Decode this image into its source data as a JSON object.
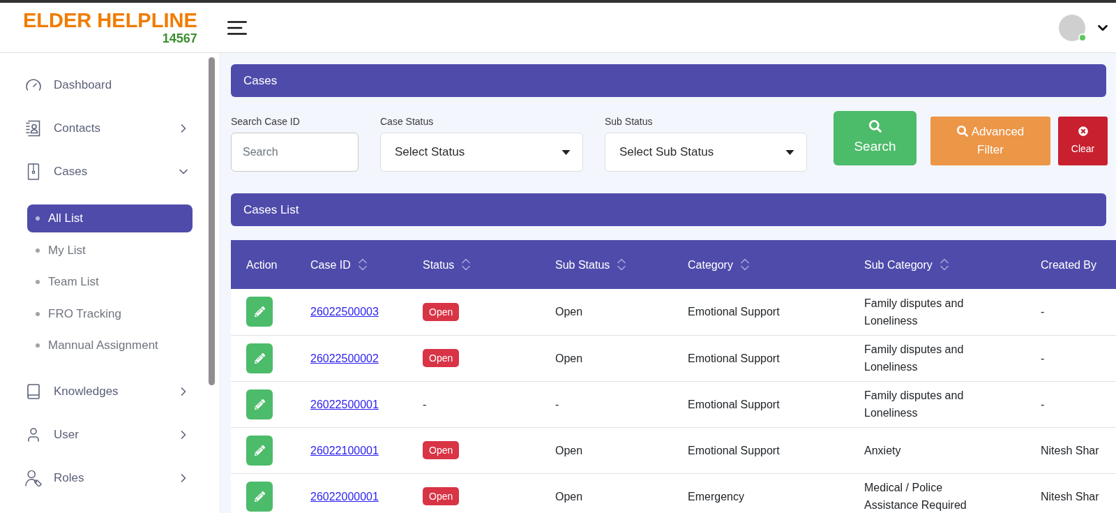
{
  "header": {
    "logo": {
      "title": "ELDER HELPLINE",
      "number": "14567"
    },
    "avatar": {
      "online": true
    }
  },
  "sidebar": {
    "items": [
      {
        "label": "Dashboard",
        "kind": "link"
      },
      {
        "label": "Contacts",
        "kind": "group",
        "expanded": false
      },
      {
        "label": "Cases",
        "kind": "group",
        "expanded": true,
        "children": [
          {
            "label": "All List",
            "selected": true
          },
          {
            "label": "My List",
            "selected": false
          },
          {
            "label": "Team List",
            "selected": false
          },
          {
            "label": "FRO Tracking",
            "selected": false
          },
          {
            "label": "Mannual Assignment",
            "selected": false
          }
        ]
      },
      {
        "label": "Knowledges",
        "kind": "group",
        "expanded": false
      },
      {
        "label": "User",
        "kind": "group",
        "expanded": false
      },
      {
        "label": "Roles",
        "kind": "group",
        "expanded": false
      }
    ]
  },
  "search_panel": {
    "title": "Cases",
    "filters": [
      {
        "kind": "input",
        "label": "Search Case ID",
        "placeholder": "Search"
      },
      {
        "kind": "select",
        "label": "Case Status",
        "value": "Select Status"
      },
      {
        "kind": "select",
        "label": "Sub Status",
        "value": "Select Sub Status"
      }
    ],
    "buttons": [
      {
        "kind": "search",
        "label": "Search"
      },
      {
        "kind": "advanced",
        "label": "Advanced Filter"
      },
      {
        "kind": "clear",
        "label": "Clear"
      }
    ]
  },
  "list_panel": {
    "title": "Cases List",
    "table": {
      "columns": [
        {
          "label": "Action",
          "sortable": false
        },
        {
          "label": "Case ID",
          "sortable": true
        },
        {
          "label": "Status",
          "sortable": true
        },
        {
          "label": "Sub Status",
          "sortable": true
        },
        {
          "label": "Category",
          "sortable": true
        },
        {
          "label": "Sub Category",
          "sortable": true
        },
        {
          "label": "Created By",
          "sortable": false
        }
      ],
      "rows": [
        {
          "case_id": "26022500003",
          "status": {
            "kind": "badge",
            "text": "Open"
          },
          "sub_status": "Open",
          "category": "Emotional Support",
          "sub_category": "Family disputes and Loneliness",
          "created_by": "-"
        },
        {
          "case_id": "26022500002",
          "status": {
            "kind": "badge",
            "text": "Open"
          },
          "sub_status": "Open",
          "category": "Emotional Support",
          "sub_category": "Family disputes and Loneliness",
          "created_by": "-"
        },
        {
          "case_id": "26022500001",
          "status": {
            "kind": "plain",
            "text": "-"
          },
          "sub_status": "-",
          "category": "Emotional Support",
          "sub_category": "Family disputes and Loneliness",
          "created_by": "-"
        },
        {
          "case_id": "26022100001",
          "status": {
            "kind": "badge",
            "text": "Open"
          },
          "sub_status": "Open",
          "category": "Emotional Support",
          "sub_category": "Anxiety",
          "created_by": "Nitesh Shar"
        },
        {
          "case_id": "26022000001",
          "status": {
            "kind": "badge",
            "text": "Open"
          },
          "sub_status": "Open",
          "category": "Emergency",
          "sub_category": "Medical / Police Assistance Required",
          "created_by": "Nitesh Shar"
        }
      ]
    }
  }
}
